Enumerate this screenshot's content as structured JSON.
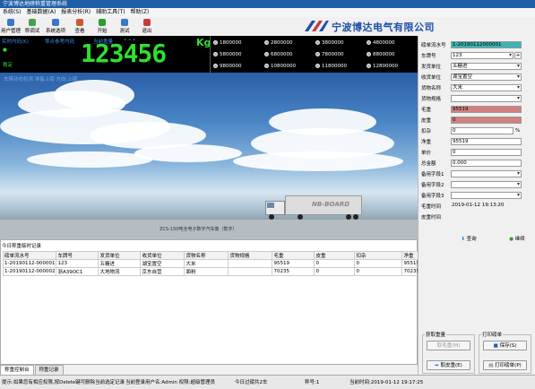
{
  "window": {
    "title": "宁波博达地磅称重管理系统"
  },
  "menu": [
    "系统(S)",
    "基础数据(A)",
    "报表分析(R)",
    "辅助工具(T)",
    "帮助(Z)"
  ],
  "toolbar": [
    {
      "label": "用户管理",
      "icon": "users-icon",
      "color": "#3a78c8"
    },
    {
      "label": "称调试",
      "icon": "scale-icon",
      "color": "#4aa04a"
    },
    {
      "label": "系统选项",
      "icon": "settings-icon",
      "color": "#3a78c8"
    },
    {
      "label": "查看",
      "icon": "view-icon",
      "color": "#c85a3a"
    },
    {
      "label": "开始",
      "icon": "play-icon",
      "color": "#2aa02a"
    },
    {
      "label": "测试",
      "icon": "test-icon",
      "color": "#3a78c8"
    },
    {
      "label": "退出",
      "icon": "exit-icon",
      "color": "#c83a3a"
    }
  ],
  "logo": {
    "text": "宁波博达电气有限公司",
    "color": "#1e4fa8"
  },
  "weigh": {
    "realtime_label": "实时内码(K)",
    "zero_label": "零点参考内码",
    "current_label": "当前重量",
    "dots": "• • •",
    "indicator1": "●",
    "indicator2": "稳定",
    "value": "123456",
    "unit": "Kg",
    "presets": [
      "1800000",
      "2800000",
      "3800000",
      "4800000",
      "5800000",
      "6800000",
      "7800000",
      "8800000",
      "9800000",
      "10800000",
      "11800000",
      "12800000"
    ]
  },
  "camera": {
    "caption": "车辆动态检测  准备上磅  方向:上磅",
    "scale_caption": "ZCS-150吨全电子数字汽车衡（数字）",
    "truck_text": "NB-BOARD"
  },
  "records": {
    "title": "今日称重临时记录",
    "headers": [
      "磅单流水号",
      "车牌号",
      "发货单位",
      "收货单位",
      "货物名称",
      "货物规格",
      "毛重",
      "皮重",
      "扣杂",
      "净重"
    ],
    "rows": [
      [
        "1-20190112-000001",
        "123",
        "五糖进",
        "湖宝置空",
        "大米",
        "",
        "95519",
        "0",
        "0",
        "95519"
      ],
      [
        "1-20190112-000002",
        "浙A39OC1",
        "大地物流",
        "京东自营",
        "面粉",
        "",
        "70235",
        "0",
        "0",
        "70235"
      ]
    ]
  },
  "tabs": [
    "称重控制台",
    "称重记录"
  ],
  "status": {
    "hint": "提示:如果您有相应权限,按Delete键可删除当前选定记录",
    "user": "当前登录用户名:Admin  权限:超级管理员",
    "today": "今日过磅共2车",
    "scale": "秤号:1",
    "time": "当前时间:2019-01-12 19:17:25"
  },
  "form": {
    "fields": [
      {
        "label": "磅单流水号",
        "value": "1-20190112000001",
        "style": "teal",
        "name": "ticket-no-field"
      },
      {
        "label": "车牌号",
        "value": "123",
        "style": "sel",
        "name": "plate-field"
      },
      {
        "label": "发货单位",
        "value": "五糖进",
        "style": "sel",
        "name": "sender-field"
      },
      {
        "label": "收货单位",
        "value": "湖宝置空",
        "style": "sel",
        "name": "receiver-field"
      },
      {
        "label": "货物名称",
        "value": "大米",
        "style": "sel",
        "name": "goods-field"
      },
      {
        "label": "货物规格",
        "value": "",
        "style": "sel",
        "name": "spec-field"
      },
      {
        "label": "毛重",
        "value": "95519",
        "style": "red",
        "name": "gross-field"
      },
      {
        "label": "皮重",
        "value": "0",
        "style": "red",
        "name": "tare-field"
      },
      {
        "label": "扣杂",
        "value": "0",
        "style": "",
        "name": "deduct-field"
      },
      {
        "label": "净重",
        "value": "95519",
        "style": "",
        "name": "net-field"
      },
      {
        "label": "单价",
        "value": "0",
        "style": "",
        "name": "price-field"
      },
      {
        "label": "总金额",
        "value": "0.000",
        "style": "",
        "name": "amount-field"
      },
      {
        "label": "备用字段1",
        "value": "",
        "style": "sel",
        "name": "spare1-field"
      },
      {
        "label": "备用字段2",
        "value": "",
        "style": "sel",
        "name": "spare2-field"
      },
      {
        "label": "备用字段3",
        "value": "",
        "style": "sel",
        "name": "spare3-field"
      },
      {
        "label": "毛重时间",
        "value": "2019-01-12 19:13:20",
        "style": "plain",
        "name": "gross-time-field"
      },
      {
        "label": "皮重时间",
        "value": "",
        "style": "plain",
        "name": "tare-time-field"
      }
    ],
    "deduct_unit": "%",
    "query_btn": "查询",
    "continue_btn": "继续",
    "get_weight_title": "获取重量",
    "get_gross_btn": "取毛重(M)",
    "get_tare_btn": "取皮重(E)",
    "print_title": "打印磅单",
    "save_btn": "保存(S)",
    "print_btn": "打印磅单(P)"
  }
}
